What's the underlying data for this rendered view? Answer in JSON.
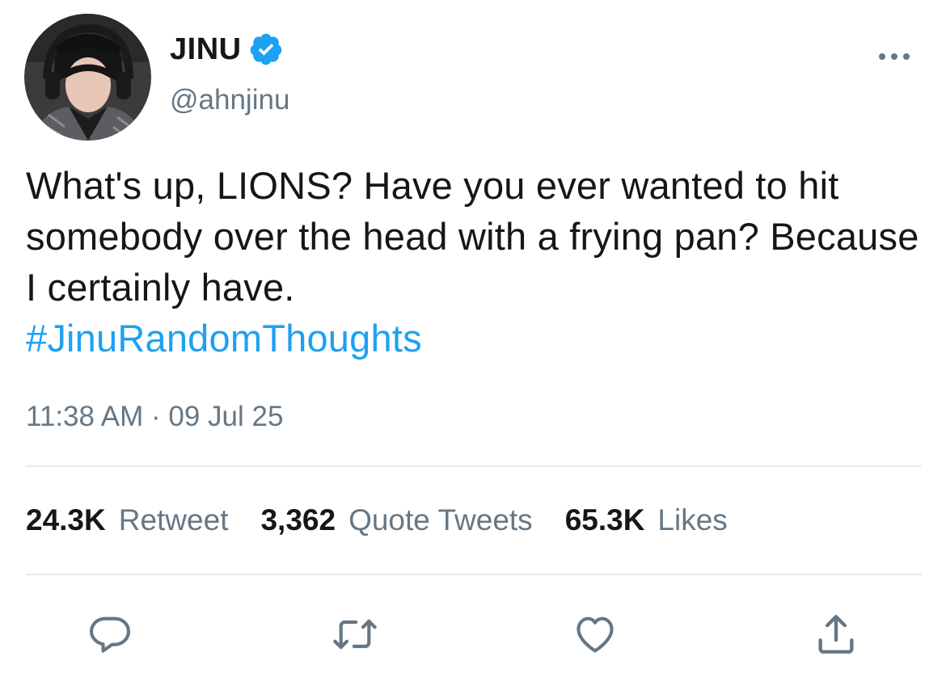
{
  "author": {
    "display_name": "JINU",
    "handle": "@ahnjinu",
    "verified": true,
    "avatar_icon": "profile-photo"
  },
  "tweet": {
    "text": "What's up, LIONS? Have you ever wanted to hit somebody over the head with a frying pan? Because I certainly have.",
    "hashtag": "#JinuRandomThoughts",
    "timestamp": "11:38 AM · 09 Jul 25"
  },
  "stats": {
    "retweets_count": "24.3K",
    "retweets_label": "Retweet",
    "quotes_count": "3,362",
    "quotes_label": "Quote Tweets",
    "likes_count": "65.3K",
    "likes_label": "Likes"
  },
  "actions": {
    "reply_icon": "reply-icon",
    "retweet_icon": "retweet-icon",
    "like_icon": "heart-icon",
    "share_icon": "share-icon"
  },
  "colors": {
    "accent": "#1da1f2",
    "text_primary": "#14171a",
    "text_secondary": "#657786",
    "divider": "#e6ecf0"
  }
}
